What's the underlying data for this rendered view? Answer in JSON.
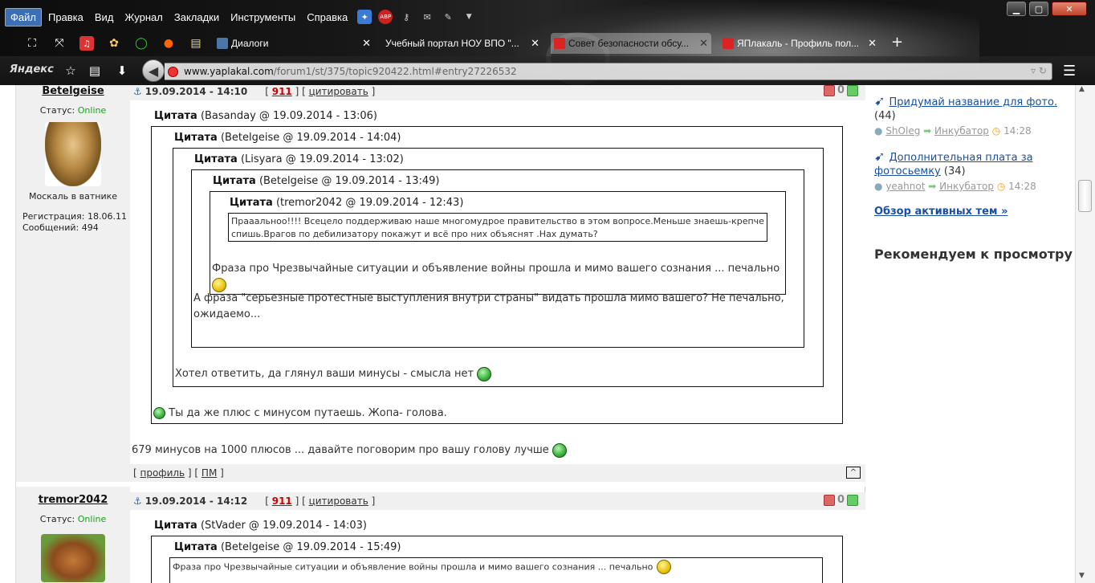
{
  "menubar": {
    "items": [
      "Файл",
      "Правка",
      "Вид",
      "Журнал",
      "Закладки",
      "Инструменты",
      "Справка"
    ],
    "abp_label": "ABP"
  },
  "tabs": [
    {
      "label": "Диалоги",
      "active": false
    },
    {
      "label": "Учебный портал НОУ ВПО \"...",
      "active": false
    },
    {
      "label": "Совет безопасности обсу...",
      "active": true
    },
    {
      "label": "ЯПлакаль - Профиль пол...",
      "active": false
    }
  ],
  "navbar": {
    "logo": "Яндекс",
    "url_domain": "www.yaplakal.com",
    "url_path": "/forum1/st/375/topic920422.html#entry27226532"
  },
  "post1": {
    "username": "Betelgeise",
    "status_label": "Статус:",
    "status": "Online",
    "user_title": "Москаль в ватнике",
    "reg_label": "Регистрация: 18.06.11",
    "posts_label": "Сообщений: 494",
    "date": "19.09.2014 - 14:10",
    "rating": "911",
    "cite_label": "цитировать",
    "votes": "0",
    "q1_head_label": "Цитата",
    "q1_head_meta": "(Basanday @ 19.09.2014 - 13:06)",
    "q2_head_label": "Цитата",
    "q2_head_meta": "(Betelgeise @ 19.09.2014 - 14:04)",
    "q3_head_label": "Цитата",
    "q3_head_meta": "(Lisyara @ 19.09.2014 - 13:02)",
    "q4_head_label": "Цитата",
    "q4_head_meta": "(Betelgeise @ 19.09.2014 - 13:49)",
    "q5_head_label": "Цитата",
    "q5_head_meta": "(tremor2042 @ 19.09.2014 - 12:43)",
    "q5_text": "Прааальноо!!!! Всецело поддерживаю наше многомудрое правительство в этом вопросе.Меньше знаешь-крепче спишь.Врагов по дебилизатору покажут и всё про них объяснят .Нах думать?",
    "q4_text": "Фраза про Чрезвычайные ситуации и объявление войны прошла и мимо вашего сознания ... печально",
    "q3_text": "А фраза \"серьезные протестные выступления внутри страны\" видать прошла мимо вашего? Не печально, ожидаемо...",
    "q2_text": "Хотел ответить, да глянул ваши минусы - смысла нет",
    "q1_text": "Ты да же плюс с минусом путаешь. Жопа- голова.",
    "main_text": "679 минусов на 1000 плюсов ... давайте поговорим про вашу голову лучше",
    "profile_label": "профиль",
    "pm_label": "ПМ",
    "up_label": "^"
  },
  "post2": {
    "username": "tremor2042",
    "status_label": "Статус:",
    "status": "Online",
    "date": "19.09.2014 - 14:12",
    "rating": "911",
    "cite_label": "цитировать",
    "votes": "0",
    "q1_head_label": "Цитата",
    "q1_head_meta": "(StVader @ 19.09.2014 - 14:03)",
    "q2_head_label": "Цитата",
    "q2_head_meta": "(Betelgeise @ 19.09.2014 - 15:49)",
    "q2_text": "Фраза про Чрезвычайные ситуации и объявление войны прошла и мимо вашего сознания ... печально"
  },
  "rightcol": {
    "topic1_title": "Придумай название для фото.",
    "topic1_count": "(44)",
    "topic1_user": "ShOleg",
    "topic1_section": "Инкубатор",
    "topic1_time": "14:28",
    "topic2_title_a": "Дополнительная плата за",
    "topic2_title_b": "фотосьемку",
    "topic2_count": "(34)",
    "topic2_user": "yeahnot",
    "topic2_section": "Инкубатор",
    "topic2_time": "14:28",
    "overview_link": "Обзор активных тем »",
    "recommend_heading": "Рекомендуем к просмотру"
  },
  "colors": {
    "link": "#1b4fa0",
    "online": "#1aa11a",
    "rating": "#cc0000",
    "postbar": "#f0f0f0"
  },
  "icons": [
    "anchor-icon",
    "smiley-icon",
    "thumb-down-icon",
    "thumb-up-icon",
    "back-icon",
    "star-icon",
    "download-icon",
    "menu-icon"
  ]
}
